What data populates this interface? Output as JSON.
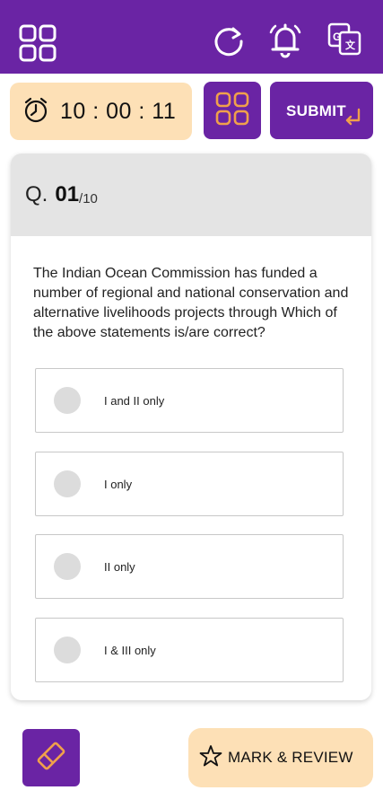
{
  "colors": {
    "primary": "#6a24a4",
    "accent": "#fde0b6",
    "orange": "#f0a04b"
  },
  "header": {
    "icons": [
      "grid-icon",
      "refresh-icon",
      "bell-icon",
      "translate-icon"
    ]
  },
  "timer": {
    "icon": "alarm-clock-icon",
    "value": "10 : 00 : 11"
  },
  "toolbar": {
    "grid_icon": "grid-icon",
    "submit_label": "SUBMIT"
  },
  "question": {
    "prefix": "Q.",
    "number": "01",
    "total": "/10",
    "text": "The Indian Ocean Commission has funded a number of regional and national conservation and alternative livelihoods projects through Which of the above statements is/are correct?",
    "options": [
      {
        "label": "I and II only",
        "selected": false
      },
      {
        "label": "I only",
        "selected": false
      },
      {
        "label": "II only",
        "selected": false
      },
      {
        "label": "I & III only",
        "selected": false
      }
    ]
  },
  "footer": {
    "eraser_icon": "eraser-icon",
    "mark_icon": "star-icon",
    "mark_label": "MARK & REVIEW"
  }
}
